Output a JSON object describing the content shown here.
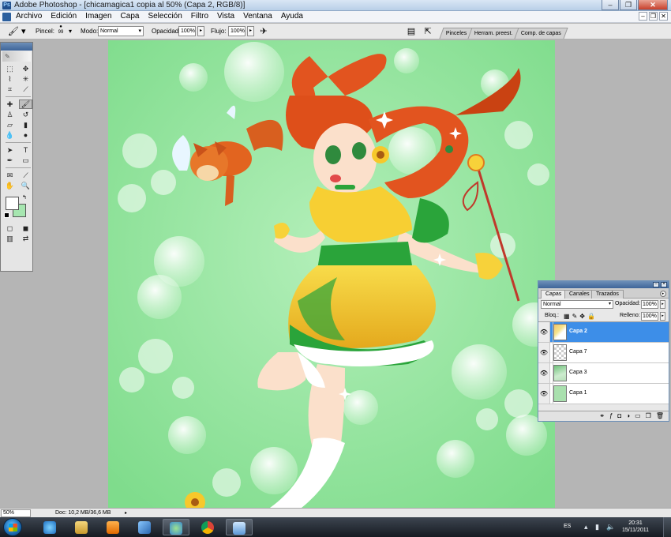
{
  "window": {
    "title": "Adobe Photoshop - [chicamagica1 copia al 50% (Capa 2, RGB/8)]"
  },
  "menu": {
    "items": [
      "Archivo",
      "Edición",
      "Imagen",
      "Capa",
      "Selección",
      "Filtro",
      "Vista",
      "Ventana",
      "Ayuda"
    ]
  },
  "options": {
    "brush_label": "Pincel:",
    "brush_size": "99",
    "mode_label": "Modo:",
    "mode_value": "Normal",
    "opacity_label": "Opacidad:",
    "opacity_value": "100%",
    "flow_label": "Flujo:",
    "flow_value": "100%"
  },
  "palette_well": {
    "tabs": [
      "Pinceles",
      "Herram. preest.",
      "Comp. de capas"
    ]
  },
  "toolbox": {
    "tools": [
      "marquee-icon",
      "move-icon",
      "lasso-icon",
      "magic-wand-icon",
      "crop-icon",
      "slice-icon",
      "healing-icon",
      "brush-icon",
      "stamp-icon",
      "history-brush-icon",
      "eraser-icon",
      "gradient-icon",
      "blur-icon",
      "dodge-icon",
      "path-select-icon",
      "type-icon",
      "pen-icon",
      "shape-icon",
      "notes-icon",
      "eyedropper-icon",
      "hand-icon",
      "zoom-icon"
    ],
    "active_tool": "brush-icon",
    "foreground_color": "#ffffff",
    "background_color": "#a6e6b0"
  },
  "layers_panel": {
    "tabs": [
      "Capas",
      "Canales",
      "Trazados"
    ],
    "active_tab": "Capas",
    "blend_mode": "Normal",
    "opacity_label": "Opacidad:",
    "opacity_value": "100%",
    "lock_label": "Bloq.:",
    "fill_label": "Relleno:",
    "fill_value": "100%",
    "layers": [
      {
        "name": "Capa 2",
        "selected": true
      },
      {
        "name": "Capa 7",
        "selected": false
      },
      {
        "name": "Capa 3",
        "selected": false
      },
      {
        "name": "Capa 1",
        "selected": false
      }
    ]
  },
  "status": {
    "zoom": "50%",
    "doc_info": "Doc: 10,2 MB/36,6 MB"
  },
  "taskbar": {
    "language": "ES",
    "time": "20:31",
    "date": "15/11/2011"
  },
  "colors": {
    "canvas_green": "#8fe39a",
    "hair": "#e2541f",
    "dress_yellow": "#f7cf33",
    "dress_green": "#2aa43a",
    "selection_blue": "#3d8ee8"
  }
}
